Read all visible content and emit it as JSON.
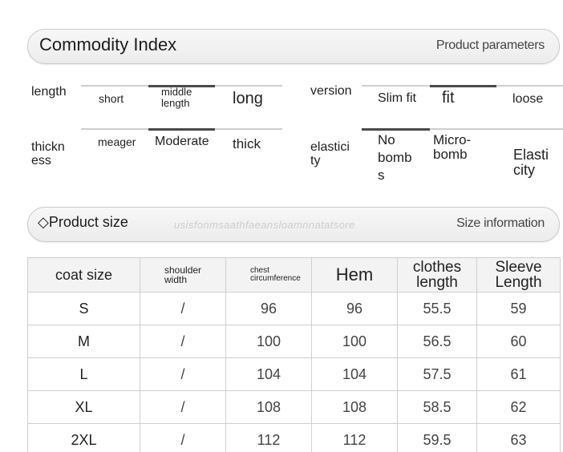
{
  "commodity": {
    "title": "Commodity Index",
    "right_label": "Product parameters"
  },
  "attributes": {
    "length": {
      "label": "length",
      "options": [
        "short",
        "middle length",
        "long"
      ],
      "selected": "middle length"
    },
    "version": {
      "label": "version",
      "options": [
        "Slim fit",
        "fit",
        "loose"
      ],
      "selected": "fit"
    },
    "thickness": {
      "label": "thickn ess",
      "options": [
        "meager",
        "Moderate",
        "thick"
      ],
      "selected": "Moderate"
    },
    "elasticity": {
      "label": "elastici ty",
      "options": [
        "No bomb s",
        "Micro- bomb",
        "Elasti city"
      ],
      "selected": "No bomb s"
    }
  },
  "product_size": {
    "title": "◇Product size",
    "watermark": "usisfonmsaathfaeansloamnnatatsore",
    "right_label": "Size information"
  },
  "size_table": {
    "headers": [
      "coat size",
      "shoulder width",
      "chest circumference",
      "Hem",
      "clothes length",
      "Sleeve Length"
    ],
    "rows": [
      [
        "S",
        "/",
        "96",
        "96",
        "55.5",
        "59"
      ],
      [
        "M",
        "/",
        "100",
        "100",
        "56.5",
        "60"
      ],
      [
        "L",
        "/",
        "104",
        "104",
        "57.5",
        "61"
      ],
      [
        "XL",
        "/",
        "108",
        "108",
        "58.5",
        "62"
      ],
      [
        "2XL",
        "/",
        "112",
        "112",
        "59.5",
        "63"
      ]
    ]
  }
}
